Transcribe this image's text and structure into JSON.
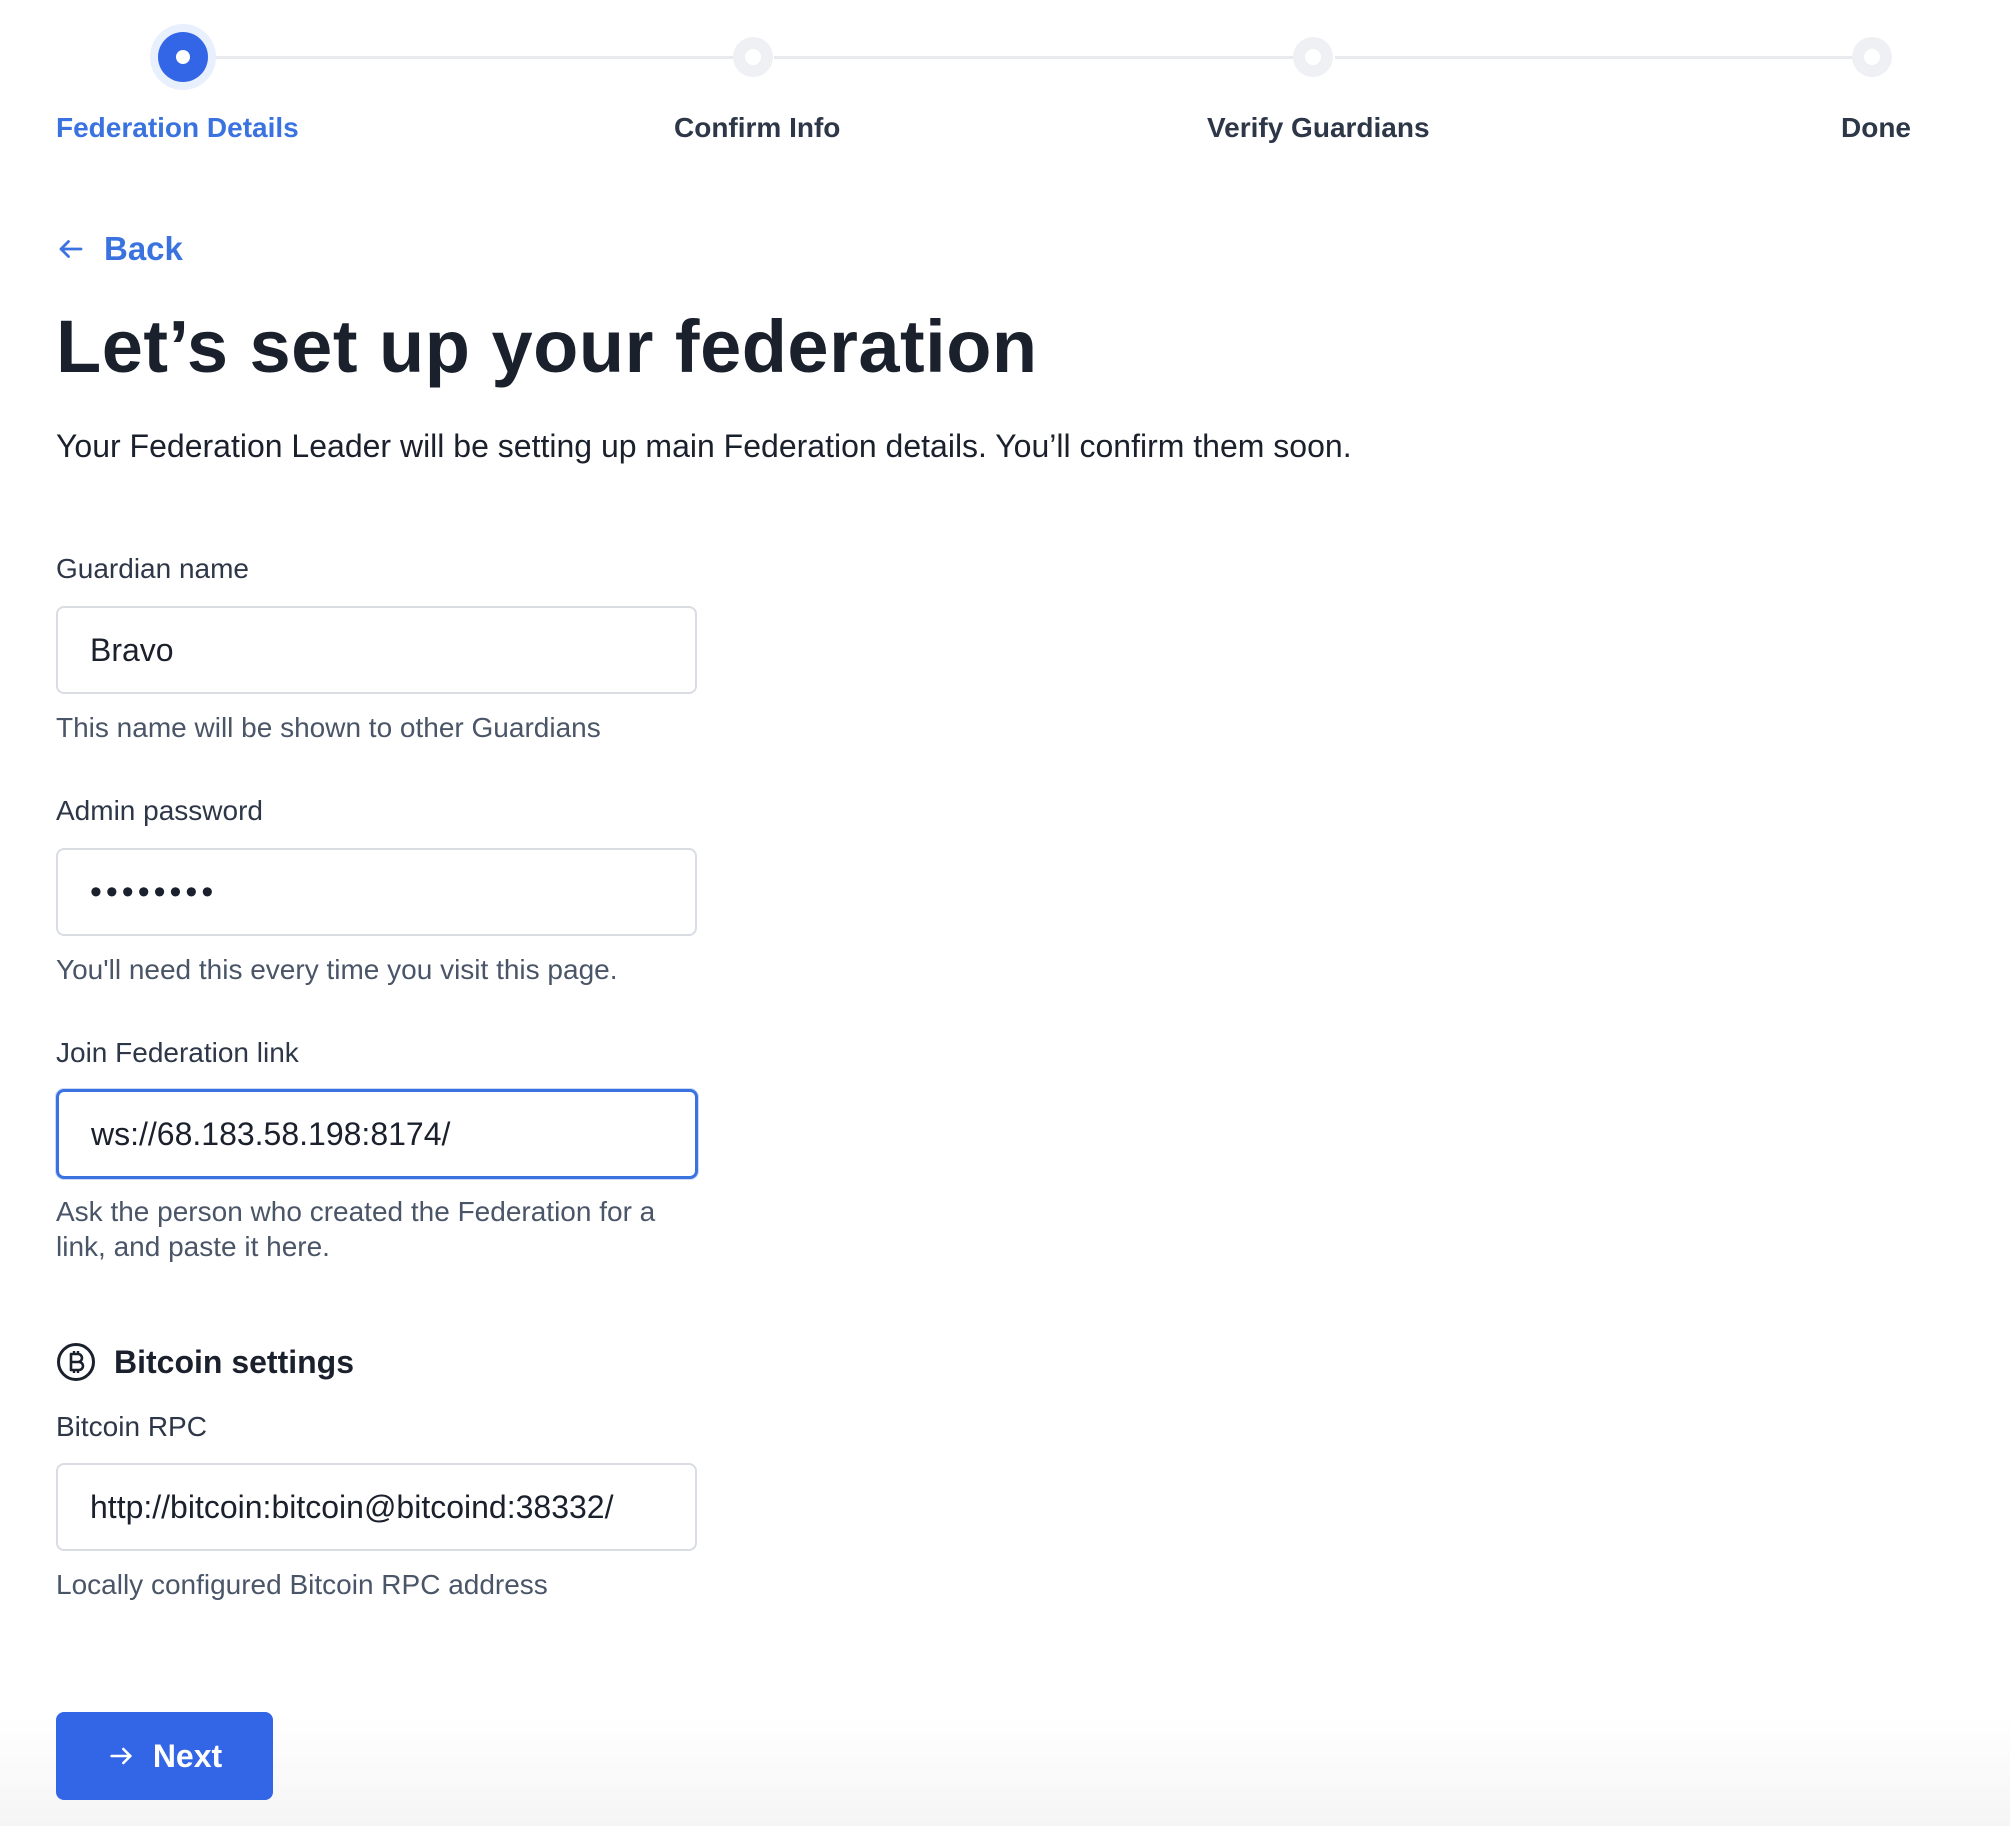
{
  "stepper": {
    "steps": [
      {
        "label": "Federation Details",
        "state": "active"
      },
      {
        "label": "Confirm Info",
        "state": "pending"
      },
      {
        "label": "Verify Guardians",
        "state": "pending"
      },
      {
        "label": "Done",
        "state": "pending"
      }
    ]
  },
  "back_label": "Back",
  "title": "Let’s set up your federation",
  "subtitle": "Your Federation Leader will be setting up main Federation details. You’ll confirm them soon.",
  "form": {
    "guardian_name": {
      "label": "Guardian name",
      "value": "Bravo",
      "help": "This name will be shown to other Guardians"
    },
    "admin_password": {
      "label": "Admin password",
      "value": "••••••••",
      "help": "You'll need this every time you visit this page."
    },
    "join_link": {
      "label": "Join Federation link",
      "value": "ws://68.183.58.198:8174/",
      "help": "Ask the person who created the Federation for a link, and paste it here."
    },
    "bitcoin_section": {
      "title": "Bitcoin settings",
      "icon": "bitcoin-icon"
    },
    "bitcoin_rpc": {
      "label": "Bitcoin RPC",
      "value": "http://bitcoin:bitcoin@bitcoind:38332/",
      "help": "Locally configured Bitcoin RPC address"
    }
  },
  "next_label": "Next",
  "colors": {
    "accent": "#3366e6",
    "link": "#3a73e0",
    "text": "#1a202c",
    "muted": "#4a5568",
    "border": "#d9dde3"
  }
}
